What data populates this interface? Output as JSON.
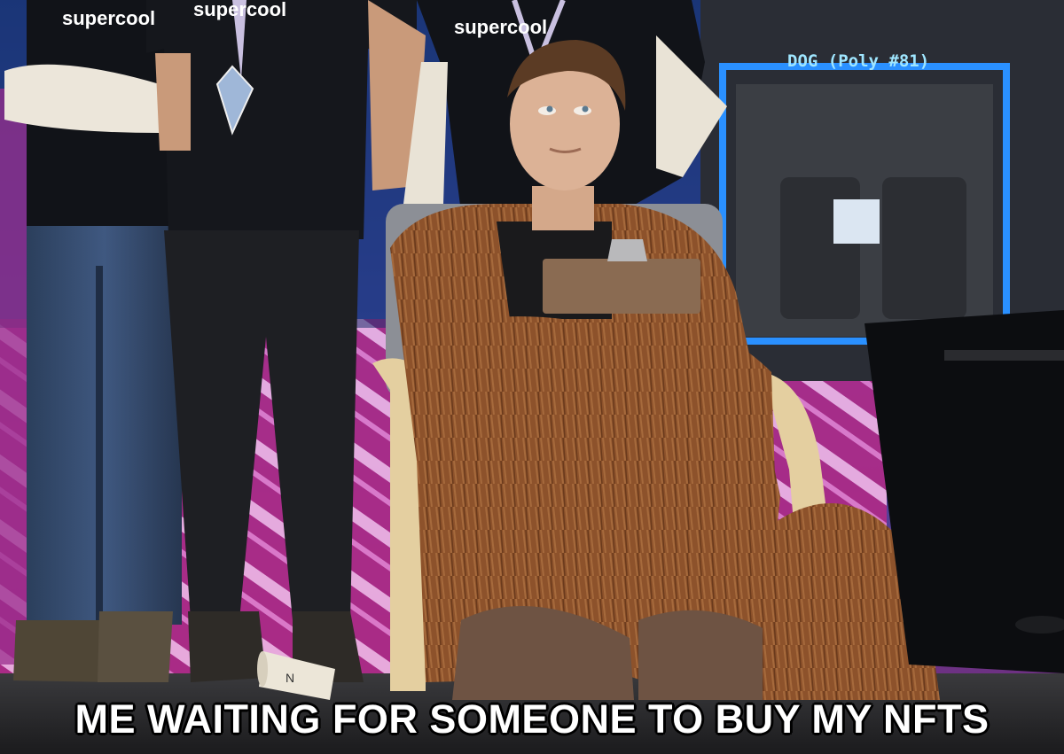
{
  "caption": "ME WAITING FOR SOMEONE TO BUY MY NFTS",
  "shirt_texts": [
    "supercool",
    "supercool",
    "supercool"
  ],
  "screen_label": "DOG (Poly #81)",
  "cup_text": "N",
  "colors": {
    "caption_text": "#ffffff",
    "caption_outline": "#000000",
    "fur": "#8a4f2a",
    "backdrop_pink": "#c2327e",
    "backdrop_blue": "#2a6fd0",
    "screen_label": "#9fe6ff"
  }
}
